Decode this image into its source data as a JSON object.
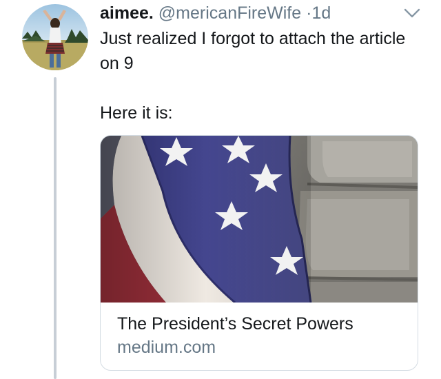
{
  "tweet": {
    "author_name": "aimee.",
    "handle": "@mericanFireWife",
    "separator": "·",
    "time": "1d",
    "text_line1": "Just realized I forgot to attach the article on 9",
    "text_line2": "Here it is:"
  },
  "link_card": {
    "title": "The President’s Secret Powers",
    "domain": "medium.com"
  },
  "icons": {
    "menu": "chevron-down-icon"
  },
  "colors": {
    "secondary_text": "#657786",
    "thread_line": "#c7ced6",
    "card_border": "#d3dbe2"
  }
}
